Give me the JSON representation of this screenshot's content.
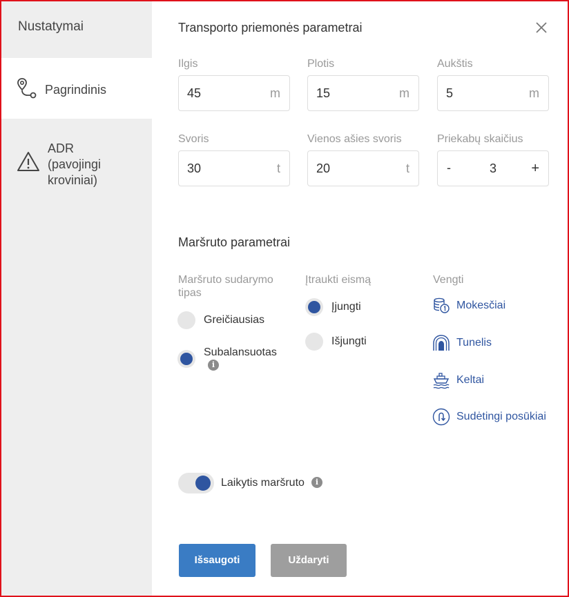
{
  "sidebar": {
    "title": "Nustatymai",
    "items": [
      {
        "label": "Pagrindinis",
        "icon": "route-pin-icon",
        "active": true
      },
      {
        "label": "ADR\n(pavojingi\nkroviniai)",
        "icon": "warning-triangle-icon",
        "active": false
      }
    ]
  },
  "vehicle": {
    "title": "Transporto priemonės parametrai",
    "length": {
      "label": "Ilgis",
      "value": "45",
      "unit": "m"
    },
    "width": {
      "label": "Plotis",
      "value": "15",
      "unit": "m"
    },
    "height": {
      "label": "Aukštis",
      "value": "5",
      "unit": "m"
    },
    "weight": {
      "label": "Svoris",
      "value": "30",
      "unit": "t"
    },
    "axle_weight": {
      "label": "Vienos ašies svoris",
      "value": "20",
      "unit": "t"
    },
    "trailers": {
      "label": "Priekabų skaičius",
      "minus": "-",
      "value": "3",
      "plus": "+"
    }
  },
  "route": {
    "title": "Maršruto parametrai",
    "type": {
      "label": "Maršruto sudarymo tipas",
      "options": [
        {
          "label": "Greičiausias",
          "selected": false
        },
        {
          "label": "Subalansuotas",
          "selected": true
        }
      ]
    },
    "traffic": {
      "label": "Įtraukti eismą",
      "options": [
        {
          "label": "Įjungti",
          "selected": true
        },
        {
          "label": "Išjungti",
          "selected": false
        }
      ]
    },
    "avoid": {
      "label": "Vengti",
      "items": [
        {
          "label": "Mokesčiai",
          "icon": "toll-coins-icon"
        },
        {
          "label": "Tunelis",
          "icon": "tunnel-icon"
        },
        {
          "label": "Keltai",
          "icon": "ferry-icon"
        },
        {
          "label": "Sudėtingi posūkiai",
          "icon": "u-turn-icon"
        }
      ]
    },
    "follow_route": {
      "label": "Laikytis maršruto",
      "enabled": true
    }
  },
  "buttons": {
    "save": "Išsaugoti",
    "close": "Uždaryti"
  },
  "colors": {
    "accent": "#2f55a0",
    "save_button": "#3a7cc4",
    "close_button": "#9e9e9e",
    "sidebar_bg": "#eeeeee",
    "frame_border": "#e0111b"
  }
}
